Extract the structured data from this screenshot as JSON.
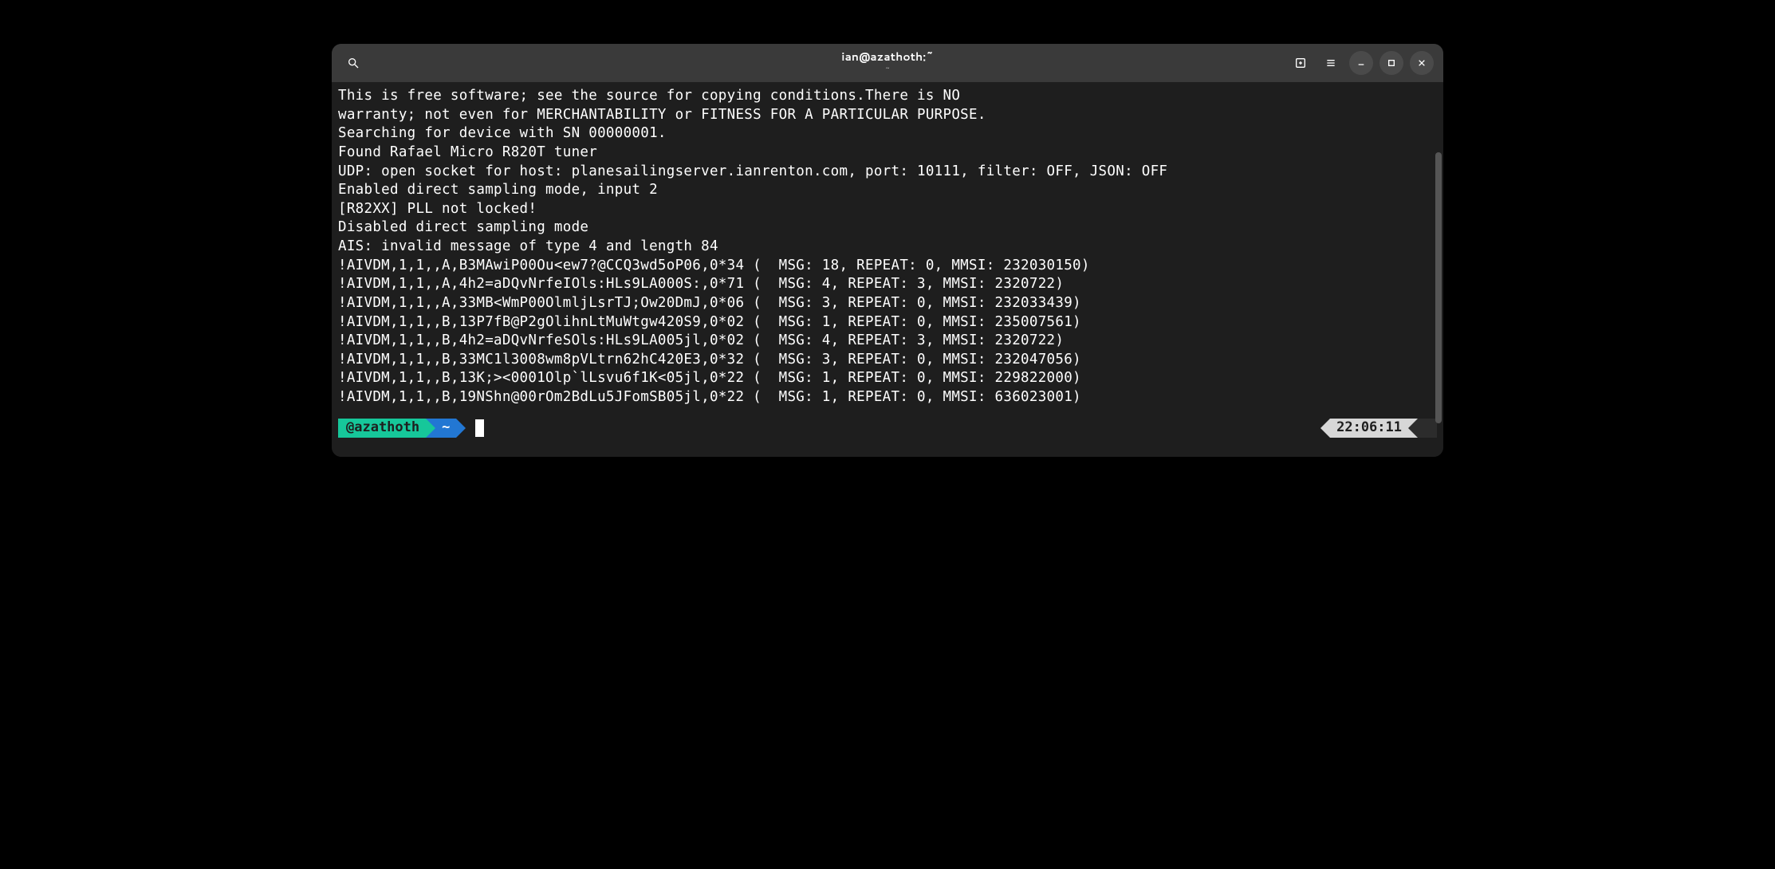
{
  "window": {
    "title": "ian@azathoth:~",
    "subtitle": "~"
  },
  "output_lines": [
    "This is free software; see the source for copying conditions.There is NO",
    "warranty; not even for MERCHANTABILITY or FITNESS FOR A PARTICULAR PURPOSE.",
    "Searching for device with SN 00000001.",
    "Found Rafael Micro R820T tuner",
    "UDP: open socket for host: planesailingserver.ianrenton.com, port: 10111, filter: OFF, JSON: OFF",
    "Enabled direct sampling mode, input 2",
    "[R82XX] PLL not locked!",
    "Disabled direct sampling mode",
    "AIS: invalid message of type 4 and length 84",
    "!AIVDM,1,1,,A,B3MAwiP00Ou<ew7?@CCQ3wd5oP06,0*34 (  MSG: 18, REPEAT: 0, MMSI: 232030150)",
    "!AIVDM,1,1,,A,4h2=aDQvNrfeIOls:HLs9LA000S:,0*71 (  MSG: 4, REPEAT: 3, MMSI: 2320722)",
    "!AIVDM,1,1,,A,33MB<WmP00OlmljLsrTJ;Ow20DmJ,0*06 (  MSG: 3, REPEAT: 0, MMSI: 232033439)",
    "!AIVDM,1,1,,B,13P7fB@P2gOlihnLtMuWtgw420S9,0*02 (  MSG: 1, REPEAT: 0, MMSI: 235007561)",
    "!AIVDM,1,1,,B,4h2=aDQvNrfeSOls:HLs9LA005jl,0*02 (  MSG: 4, REPEAT: 3, MMSI: 2320722)",
    "!AIVDM,1,1,,B,33MC1l3008wm8pVLtrn62hC420E3,0*32 (  MSG: 3, REPEAT: 0, MMSI: 232047056)",
    "!AIVDM,1,1,,B,13K;><0001Olp`lLsvu6f1K<05jl,0*22 (  MSG: 1, REPEAT: 0, MMSI: 229822000)",
    "!AIVDM,1,1,,B,19NShn@00rOm2BdLu5JFomSB05jl,0*22 (  MSG: 1, REPEAT: 0, MMSI: 636023001)"
  ],
  "prompt": {
    "host": "@azathoth",
    "path": "~",
    "clock": "22:06:11"
  }
}
